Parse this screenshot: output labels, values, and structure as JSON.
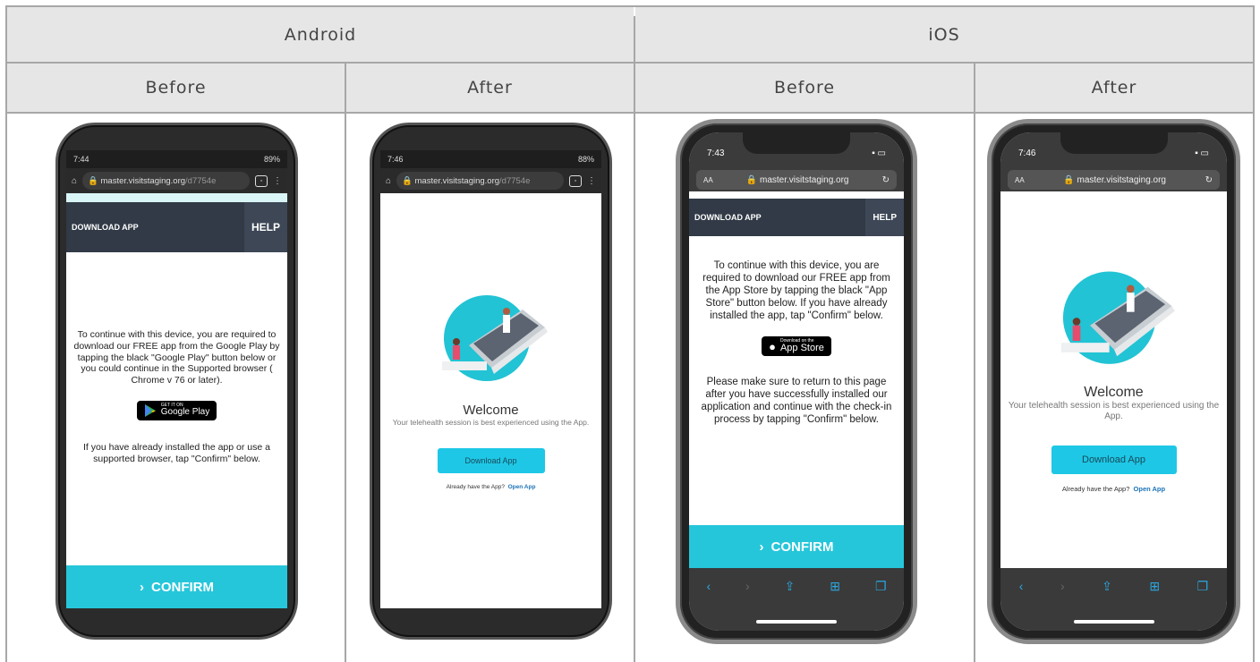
{
  "headers": {
    "android": "Android",
    "ios": "iOS",
    "before": "Before",
    "after": "After"
  },
  "android_before": {
    "time": "7:44",
    "battery": "89%",
    "url_host": "master.visitstaging.org",
    "url_path": "/d7754e",
    "download_app": "DOWNLOAD APP",
    "help": "HELP",
    "para1": "To continue with this device, you are required to download our FREE app from the Google Play by tapping the black \"Google Play\" button below or you could continue in the Supported browser ( Chrome v 76 or later).",
    "store_small": "GET IT ON",
    "store_big": "Google Play",
    "para2": "If you have already installed the app or use a supported browser, tap \"Confirm\" below.",
    "confirm": "CONFIRM"
  },
  "android_after": {
    "time": "7:46",
    "battery": "88%",
    "url_host": "master.visitstaging.org",
    "url_path": "/d7754e",
    "welcome": "Welcome",
    "subtitle": "Your telehealth session is best experienced using the App.",
    "download_btn": "Download App",
    "already": "Already have the App?",
    "open_app": "Open App"
  },
  "ios_before": {
    "time": "7:43",
    "aa": "AA",
    "url_host": "master.visitstaging.org",
    "download_app": "DOWNLOAD APP",
    "help": "HELP",
    "para1": "To continue with this device, you are required to download our FREE app from the App Store by tapping the black \"App Store\" button below. If you have already installed the app, tap \"Confirm\" below.",
    "store_small": "Download on the",
    "store_big": "App Store",
    "para2": "Please make sure to return to this page after you have successfully installed our application and continue with the check-in process by tapping \"Confirm\" below.",
    "confirm": "CONFIRM"
  },
  "ios_after": {
    "time": "7:46",
    "aa": "AA",
    "url_host": "master.visitstaging.org",
    "welcome": "Welcome",
    "subtitle": "Your telehealth session is best experienced using the App.",
    "download_btn": "Download App",
    "already": "Already have the App?",
    "open_app": "Open App"
  },
  "colors": {
    "confirm": "#26c6da",
    "download_button": "#1ec7e6",
    "header_bg": "#e6e6e6",
    "nav_bar": "#313a46"
  }
}
